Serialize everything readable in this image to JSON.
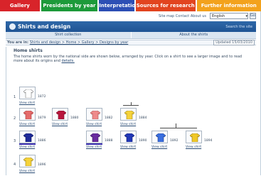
{
  "tabs": [
    {
      "label": "Gallery",
      "color": "#d8242a"
    },
    {
      "label": "Presidents by year",
      "color": "#1d9a3a"
    },
    {
      "label": "Interpretation",
      "color": "#2d4fb5"
    },
    {
      "label": "Sources for research",
      "color": "#e2441f"
    },
    {
      "label": "Further information",
      "color": "#f3a21c"
    }
  ],
  "utility": {
    "links": "Site map  Contact  About us",
    "language": "English",
    "go": "Go"
  },
  "banner": {
    "title": "Shirts and design",
    "right": "Search the site"
  },
  "subnav": {
    "items": [
      "Shirt collection",
      "About the shirts"
    ]
  },
  "crumbs": {
    "prefix": "You are in:",
    "links": "Shirts and design > Home > Gallery > Designs by year",
    "date": "Updated 15/03/2010"
  },
  "content": {
    "title": "Home shirts",
    "text": "The home shirts worn by the national side are shown below, arranged by year. Click on a shirt to see a larger image and to read more about its origins and",
    "more": "details."
  },
  "rows": [
    {
      "num": "1",
      "items": [
        {
          "label": "1872",
          "link": "View shirt",
          "color": "#ffffff",
          "outline": "#777777",
          "selected": false
        }
      ]
    },
    {
      "num": "2",
      "items": [
        {
          "label": "1879",
          "link": "View shirt",
          "color": "#e46a6a",
          "outline": "#a83a3a",
          "selected": false
        },
        {
          "label": "1880",
          "link": "View shirt",
          "color": "#b9173e",
          "outline": "#7a1028",
          "selected": false
        },
        {
          "label": "1882",
          "link": "View shirt",
          "color": "#ee8a8a",
          "outline": "#a85050",
          "selected": false
        },
        {
          "label": "1884",
          "link": "View shirt",
          "color": "#f5d23a",
          "outline": "#9a8420",
          "selected": false
        }
      ]
    },
    {
      "num": "3",
      "items": [
        {
          "label": "1886",
          "link": "View shirt",
          "color": "#1e2b9a",
          "outline": "#101860",
          "selected": true
        },
        {
          "label": "1888",
          "link": "View shirt",
          "color": "#6a2ca0",
          "outline": "#3e1a60",
          "selected": true
        },
        {
          "label": "1890",
          "link": "View shirt",
          "color": "#2138b8",
          "outline": "#122070",
          "selected": false
        },
        {
          "label": "1892",
          "link": "View shirt",
          "color": "#3a6fe0",
          "outline": "#1f3f88",
          "selected": false
        },
        {
          "label": "1894",
          "link": "View shirt",
          "color": "#f0c828",
          "outline": "#907818",
          "selected": false
        }
      ]
    },
    {
      "num": "4",
      "items": [
        {
          "label": "1896",
          "link": "View shirt",
          "color": "#f5d23a",
          "outline": "#9a8420",
          "selected": false
        }
      ]
    }
  ]
}
